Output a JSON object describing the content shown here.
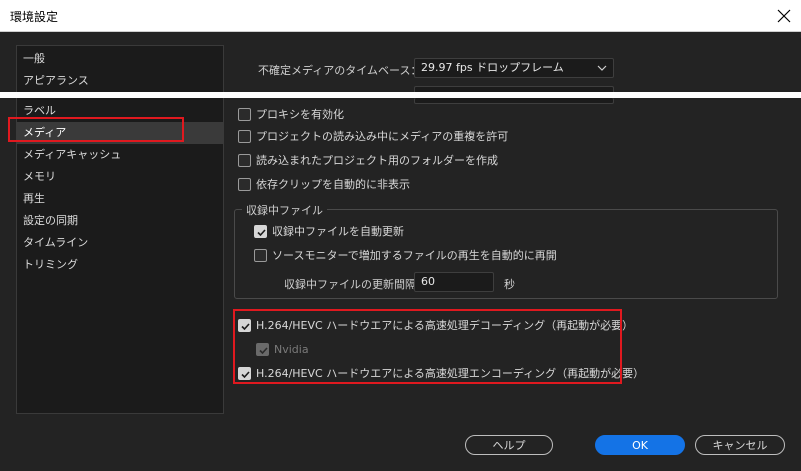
{
  "window": {
    "title": "環境設定"
  },
  "sidebar": {
    "items": [
      {
        "label": "一般"
      },
      {
        "label": "アピアランス"
      },
      {
        "label": "ラベル"
      },
      {
        "label": "メディア"
      },
      {
        "label": "メディアキャッシュ"
      },
      {
        "label": "メモリ"
      },
      {
        "label": "再生"
      },
      {
        "label": "設定の同期"
      },
      {
        "label": "タイムライン"
      },
      {
        "label": "トリミング"
      }
    ],
    "selected_index": 3
  },
  "media": {
    "timebase_label": "不確定メディアのタイムベース：",
    "timebase_value": "29.97  fps ドロップフレーム",
    "options": [
      {
        "label": "プロキシを有効化",
        "checked": false
      },
      {
        "label": "プロジェクトの読み込み中にメディアの重複を許可",
        "checked": false
      },
      {
        "label": "読み込まれたプロジェクト用のフォルダーを作成",
        "checked": false
      },
      {
        "label": "依存クリップを自動的に非表示",
        "checked": false
      }
    ],
    "growing": {
      "legend": "収録中ファイル",
      "auto_refresh": {
        "label": "収録中ファイルを自動更新",
        "checked": true
      },
      "auto_play": {
        "label": "ソースモニターで増加するファイルの再生を自動的に再開",
        "checked": false
      },
      "interval_label": "収録中ファイルの更新間隔",
      "interval_value": "60",
      "unit": "秒"
    },
    "hw": {
      "decode": {
        "label": "H.264/HEVC ハードウエアによる高速処理デコーディング（再起動が必要）",
        "checked": true
      },
      "nvidia": {
        "label": "Nvidia",
        "checked": true,
        "disabled": true
      },
      "encode": {
        "label": "H.264/HEVC ハードウエアによる高速処理エンコーディング（再起動が必要）",
        "checked": true
      }
    }
  },
  "footer": {
    "help": "ヘルプ",
    "ok": "OK",
    "cancel": "キャンセル"
  },
  "colors": {
    "highlight_red": "#e0191f",
    "accent_blue": "#1473e6"
  }
}
